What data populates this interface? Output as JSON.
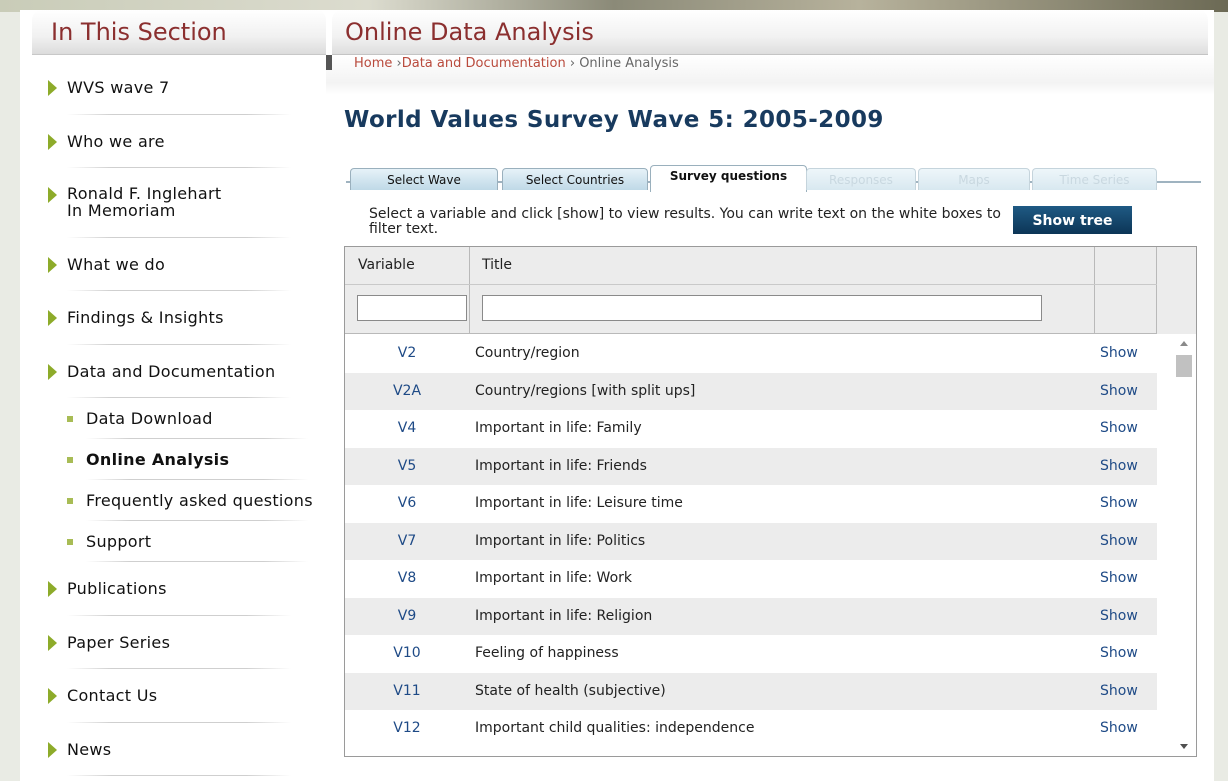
{
  "sidebar": {
    "title": "In This Section",
    "items": [
      {
        "label": "WVS wave 7"
      },
      {
        "label": "Who we are"
      },
      {
        "label": "Ronald F. Inglehart"
      },
      {
        "label": "What we do"
      },
      {
        "label": "Findings & Insights"
      },
      {
        "label": "Data and Documentation"
      },
      {
        "label": "Publications"
      },
      {
        "label": "Paper Series"
      },
      {
        "label": "Contact Us"
      },
      {
        "label": "News"
      }
    ],
    "item2_line2": "In Memoriam",
    "sub_items": [
      {
        "label": "Data Download"
      },
      {
        "label": "Online Analysis"
      },
      {
        "label": "Frequently asked questions"
      },
      {
        "label": "Support"
      }
    ]
  },
  "header": {
    "title": "Online Data Analysis",
    "breadcrumb": {
      "home": "Home",
      "sep1": " ›",
      "section": "Data and Documentation",
      "sep2": " › ",
      "current": "Online Analysis"
    }
  },
  "main": {
    "page_title": "World Values Survey Wave 5: 2005-2009",
    "tabs": [
      {
        "label": "Select Wave",
        "state": "enabled"
      },
      {
        "label": "Select Countries",
        "state": "enabled"
      },
      {
        "label": "Survey questions",
        "state": "active"
      },
      {
        "label": "Responses",
        "state": "disabled"
      },
      {
        "label": "Maps",
        "state": "disabled"
      },
      {
        "label": "Time Series",
        "state": "disabled"
      }
    ],
    "instructions": "Select a variable and click [show] to view results. You can write text on the white boxes to filter text.",
    "show_tree_label": "Show tree"
  },
  "table": {
    "columns": {
      "variable": "Variable",
      "title": "Title"
    },
    "filter_variable_value": "",
    "filter_title_value": "",
    "rows": [
      {
        "var": "V2",
        "title": "Country/region",
        "action": "Show"
      },
      {
        "var": "V2A",
        "title": "Country/regions [with split ups]",
        "action": "Show"
      },
      {
        "var": "V4",
        "title": "Important in life: Family",
        "action": "Show"
      },
      {
        "var": "V5",
        "title": "Important in life: Friends",
        "action": "Show"
      },
      {
        "var": "V6",
        "title": "Important in life: Leisure time",
        "action": "Show"
      },
      {
        "var": "V7",
        "title": "Important in life: Politics",
        "action": "Show"
      },
      {
        "var": "V8",
        "title": "Important in life: Work",
        "action": "Show"
      },
      {
        "var": "V9",
        "title": "Important in life: Religion",
        "action": "Show"
      },
      {
        "var": "V10",
        "title": "Feeling of happiness",
        "action": "Show"
      },
      {
        "var": "V11",
        "title": "State of health (subjective)",
        "action": "Show"
      },
      {
        "var": "V12",
        "title": "Important child qualities: independence",
        "action": "Show"
      }
    ]
  },
  "colors": {
    "section_title": "#8b2f2f",
    "link": "#b94a3c",
    "page_title": "#183a5e",
    "nav_arrow": "#8dab2a",
    "button": "#0c3556"
  }
}
